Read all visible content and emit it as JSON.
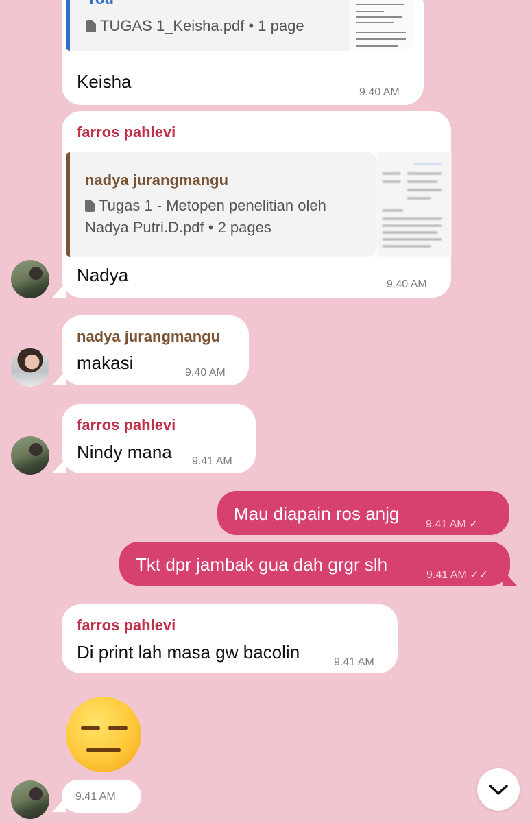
{
  "messages": {
    "m1": {
      "reply_name": "You",
      "reply_file": "TUGAS 1_Keisha.pdf",
      "reply_pages": "1 page",
      "text": "Keisha",
      "time": "9.40 AM"
    },
    "m2": {
      "sender": "farros pahlevi",
      "reply_name": "nadya jurangmangu",
      "reply_file_line1": "Tugas 1 - Metopen penelitian oleh",
      "reply_file_line2": "Nadya Putri.D.pdf",
      "reply_pages": "2 pages",
      "text": "Nadya",
      "time": "9.40 AM"
    },
    "m3": {
      "sender": "nadya jurangmangu",
      "text": "makasi",
      "time": "9.40 AM"
    },
    "m4": {
      "sender": "farros pahlevi",
      "text": "Nindy mana",
      "time": "9.41 AM"
    },
    "m5": {
      "text": "Mau diapain ros anjg",
      "time": "9.41 AM",
      "status": "✓"
    },
    "m6": {
      "text": "Tkt dpr jambak gua dah grgr slh",
      "time": "9.41 AM",
      "status": "✓✓"
    },
    "m7": {
      "sender": "farros pahlevi",
      "text": "Di print lah masa gw bacolin",
      "time": "9.41 AM"
    },
    "m8": {
      "emoji": "expressionless-face",
      "time": "9.41 AM"
    }
  },
  "colors": {
    "background": "#f2c6d0",
    "outgoing": "#d6416f",
    "you_name": "#2f6fc6",
    "farros_name": "#c0304a",
    "nadya_name": "#7a5234"
  },
  "icons": {
    "scroll_down": "chevron-down-icon",
    "file": "document-icon"
  }
}
